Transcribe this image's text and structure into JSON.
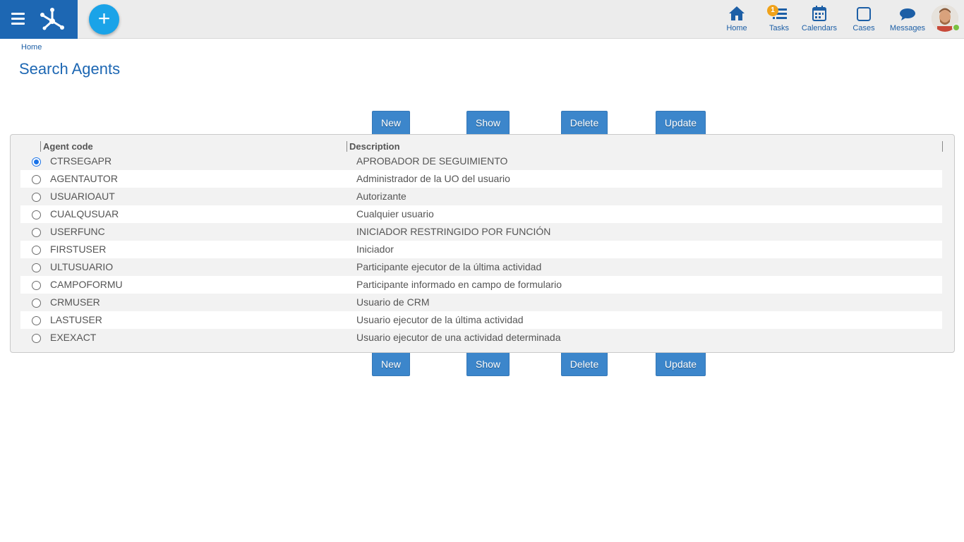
{
  "header": {
    "nav": [
      {
        "label": "Home",
        "icon": "home-icon"
      },
      {
        "label": "Tasks",
        "icon": "tasks-icon",
        "badge": "1"
      },
      {
        "label": "Calendars",
        "icon": "calendar-icon"
      },
      {
        "label": "Cases",
        "icon": "cases-icon"
      },
      {
        "label": "Messages",
        "icon": "messages-icon"
      }
    ],
    "add_symbol": "+"
  },
  "breadcrumb": "Home",
  "title": "Search Agents",
  "actions": {
    "new": "New",
    "show": "Show",
    "delete": "Delete",
    "update": "Update"
  },
  "table": {
    "columns": [
      "Agent code",
      "Description"
    ],
    "rows": [
      {
        "code": "CTRSEGAPR",
        "description": "APROBADOR DE SEGUIMIENTO",
        "selected": true
      },
      {
        "code": "AGENTAUTOR",
        "description": "Administrador de la UO del usuario",
        "selected": false
      },
      {
        "code": "USUARIOAUT",
        "description": "Autorizante",
        "selected": false
      },
      {
        "code": "CUALQUSUAR",
        "description": "Cualquier usuario",
        "selected": false
      },
      {
        "code": "USERFUNC",
        "description": "INICIADOR RESTRINGIDO POR FUNCIÓN",
        "selected": false
      },
      {
        "code": "FIRSTUSER",
        "description": "Iniciador",
        "selected": false
      },
      {
        "code": "ULTUSUARIO",
        "description": "Participante ejecutor de la última actividad",
        "selected": false
      },
      {
        "code": "CAMPOFORMU",
        "description": "Participante informado en campo de formulario",
        "selected": false
      },
      {
        "code": "CRMUSER",
        "description": "Usuario de CRM",
        "selected": false
      },
      {
        "code": "LASTUSER",
        "description": "Usuario ejecutor de la última actividad",
        "selected": false
      },
      {
        "code": "EXEXACT",
        "description": "Usuario ejecutor de una actividad determinada",
        "selected": false
      }
    ]
  },
  "colors": {
    "primary": "#1d67b3",
    "button": "#3c86cb",
    "accent": "#1aa3e8",
    "badge": "#f0a21a",
    "online": "#7ac142"
  }
}
